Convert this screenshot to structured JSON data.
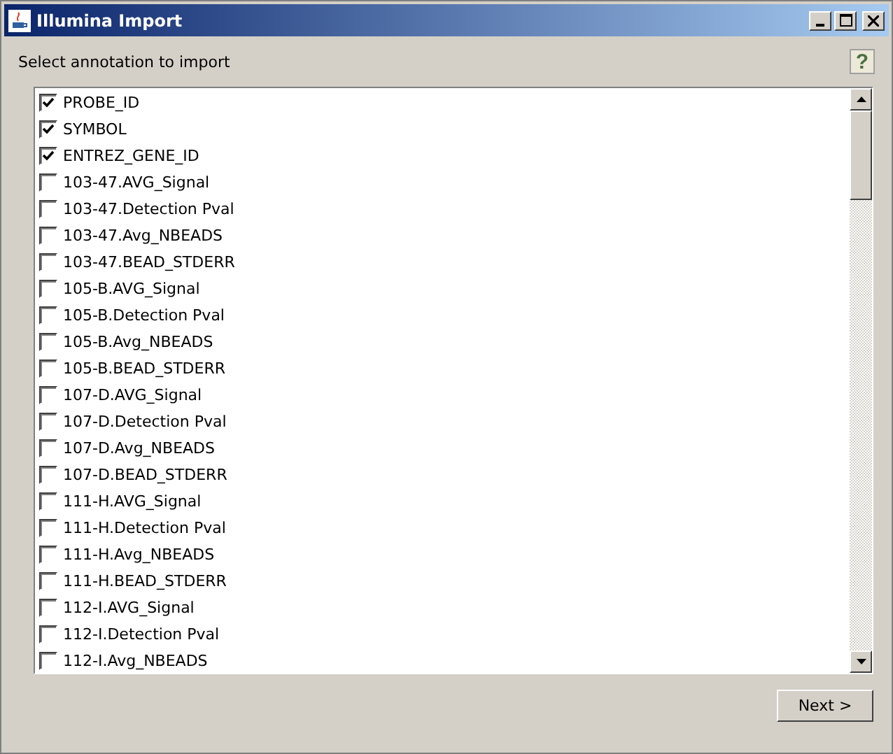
{
  "window": {
    "title": "Illumina Import"
  },
  "prompt": "Select annotation to import",
  "help": "?",
  "items": [
    {
      "label": "PROBE_ID",
      "checked": true
    },
    {
      "label": "SYMBOL",
      "checked": true
    },
    {
      "label": "ENTREZ_GENE_ID",
      "checked": true
    },
    {
      "label": "103-47.AVG_Signal",
      "checked": false
    },
    {
      "label": "103-47.Detection Pval",
      "checked": false
    },
    {
      "label": "103-47.Avg_NBEADS",
      "checked": false
    },
    {
      "label": "103-47.BEAD_STDERR",
      "checked": false
    },
    {
      "label": "105-B.AVG_Signal",
      "checked": false
    },
    {
      "label": "105-B.Detection Pval",
      "checked": false
    },
    {
      "label": "105-B.Avg_NBEADS",
      "checked": false
    },
    {
      "label": "105-B.BEAD_STDERR",
      "checked": false
    },
    {
      "label": "107-D.AVG_Signal",
      "checked": false
    },
    {
      "label": "107-D.Detection Pval",
      "checked": false
    },
    {
      "label": "107-D.Avg_NBEADS",
      "checked": false
    },
    {
      "label": "107-D.BEAD_STDERR",
      "checked": false
    },
    {
      "label": "111-H.AVG_Signal",
      "checked": false
    },
    {
      "label": "111-H.Detection Pval",
      "checked": false
    },
    {
      "label": "111-H.Avg_NBEADS",
      "checked": false
    },
    {
      "label": "111-H.BEAD_STDERR",
      "checked": false
    },
    {
      "label": "112-I.AVG_Signal",
      "checked": false
    },
    {
      "label": "112-I.Detection Pval",
      "checked": false
    },
    {
      "label": "112-I.Avg_NBEADS",
      "checked": false
    }
  ],
  "next_button": "Next >"
}
